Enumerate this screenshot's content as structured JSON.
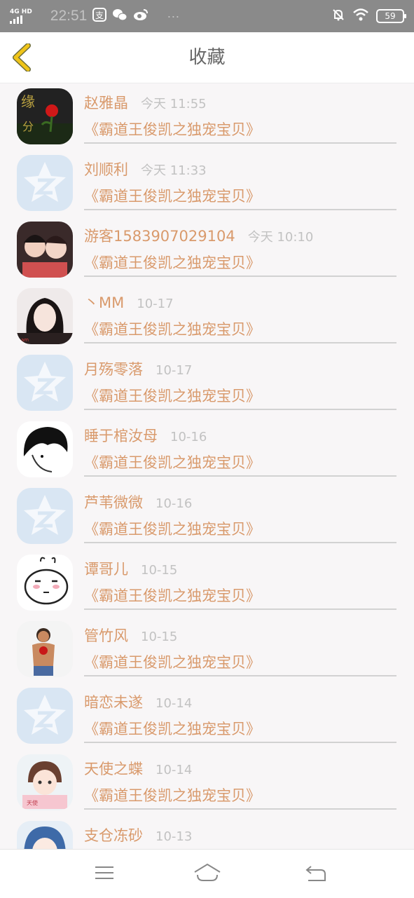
{
  "status_bar": {
    "network": "4G HD",
    "time": "22:51",
    "more": "···",
    "battery": "59",
    "icons": [
      "alipay-icon",
      "wechat-icon",
      "weibo-icon",
      "bell-off-icon",
      "wifi-icon"
    ]
  },
  "header": {
    "title": "收藏",
    "back_icon": "back-chevron-icon"
  },
  "colors": {
    "accent": "#d99a6c",
    "muted": "#c2c2c2",
    "back": "#f0c419"
  },
  "items": [
    {
      "name": "赵雅晶",
      "time": "今天 11:55",
      "book": "《霸道王俊凯之独宠宝贝》",
      "avatar": "rose-photo"
    },
    {
      "name": "刘顺利",
      "time": "今天 11:33",
      "book": "《霸道王俊凯之独宠宝贝》",
      "avatar": "default-star"
    },
    {
      "name": "游客1583907029104",
      "time": "今天 10:10",
      "book": "《霸道王俊凯之独宠宝贝》",
      "avatar": "two-people-photo"
    },
    {
      "name": "丶MM",
      "time": "10-17",
      "book": "《霸道王俊凯之独宠宝贝》",
      "avatar": "girl-photo"
    },
    {
      "name": "月殇零落",
      "time": "10-17",
      "book": "《霸道王俊凯之独宠宝贝》",
      "avatar": "default-star"
    },
    {
      "name": "睡于棺汝母",
      "time": "10-16",
      "book": "《霸道王俊凯之独宠宝贝》",
      "avatar": "anime-sketch"
    },
    {
      "name": "芦苇微微",
      "time": "10-16",
      "book": "《霸道王俊凯之独宠宝贝》",
      "avatar": "default-star"
    },
    {
      "name": "谭哥儿",
      "time": "10-15",
      "book": "《霸道王俊凯之独宠宝贝》",
      "avatar": "rabbit-cartoon"
    },
    {
      "name": "管竹风",
      "time": "10-15",
      "book": "《霸道王俊凯之独宠宝贝》",
      "avatar": "man-photo"
    },
    {
      "name": "暗恋未遂",
      "time": "10-14",
      "book": "《霸道王俊凯之独宠宝贝》",
      "avatar": "default-star"
    },
    {
      "name": "天使之蝶",
      "time": "10-14",
      "book": "《霸道王俊凯之独宠宝贝》",
      "avatar": "cartoon-girl"
    },
    {
      "name": "支仓冻砂",
      "time": "10-13",
      "book": "",
      "avatar": "anime-blue"
    }
  ],
  "nav": [
    "menu-icon",
    "home-icon",
    "back-icon"
  ]
}
